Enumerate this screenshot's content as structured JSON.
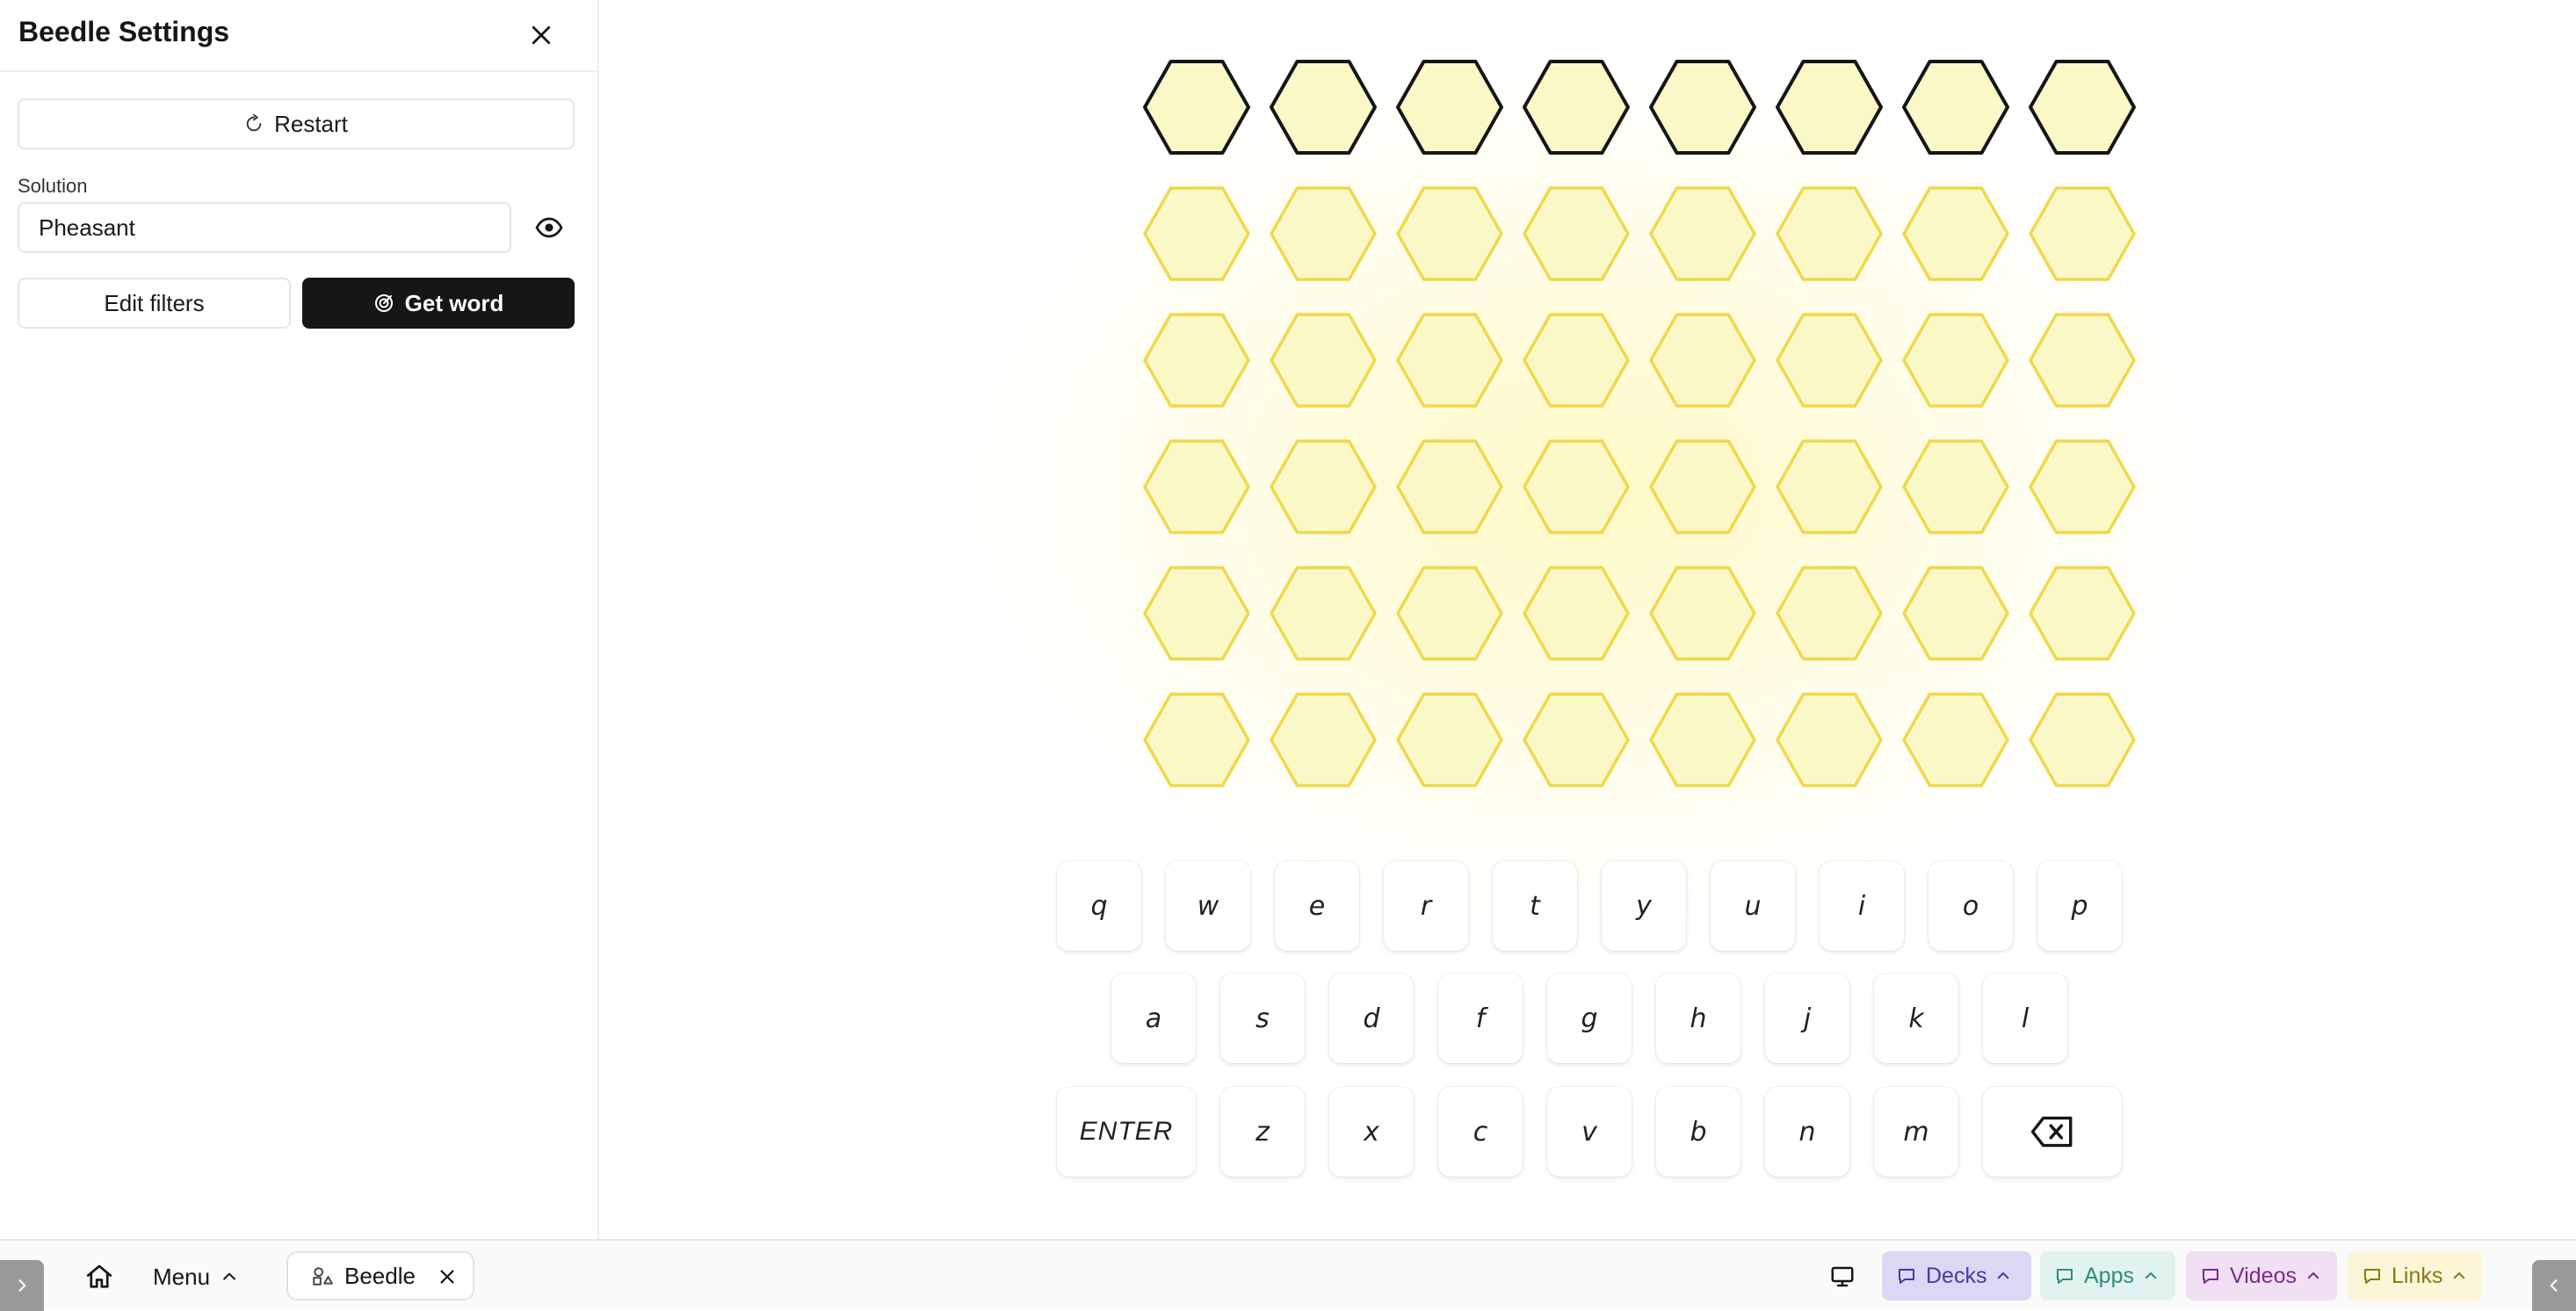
{
  "sidebar": {
    "title": "Beedle Settings",
    "restart_label": "Restart",
    "solution_label": "Solution",
    "solution_value": "Pheasant",
    "edit_filters_label": "Edit filters",
    "get_word_label": "Get word"
  },
  "board": {
    "columns": 8,
    "rows": 6,
    "active_row": 0,
    "colors": {
      "fill": "#fbf8c8",
      "active_stroke": "#161616",
      "stroke": "#f0d84a"
    }
  },
  "keyboard": {
    "rows": [
      [
        "q",
        "w",
        "e",
        "r",
        "t",
        "y",
        "u",
        "i",
        "o",
        "p"
      ],
      [
        "a",
        "s",
        "d",
        "f",
        "g",
        "h",
        "j",
        "k",
        "l"
      ],
      [
        "ENTER",
        "z",
        "x",
        "c",
        "v",
        "b",
        "n",
        "m",
        "backspace-icon"
      ]
    ]
  },
  "taskbar": {
    "menu_label": "Menu",
    "tab_label": "Beedle",
    "pills": [
      {
        "label": "Decks",
        "color": "#4a3aa0",
        "bg": "#ddd7f5"
      },
      {
        "label": "Apps",
        "color": "#2f8c7e",
        "bg": "#e2f3ef"
      },
      {
        "label": "Videos",
        "color": "#7a2d8c",
        "bg": "#f1dff4"
      },
      {
        "label": "Links",
        "color": "#8a7a10",
        "bg": "#fbf6d8"
      }
    ]
  },
  "icons": [
    "close-icon",
    "restart-icon",
    "eye-icon",
    "target-icon",
    "home-icon",
    "chevron-up-icon",
    "shapes-icon",
    "monitor-icon",
    "chat-icon",
    "chevron-left-icon",
    "chevron-right-icon",
    "backspace-icon"
  ]
}
